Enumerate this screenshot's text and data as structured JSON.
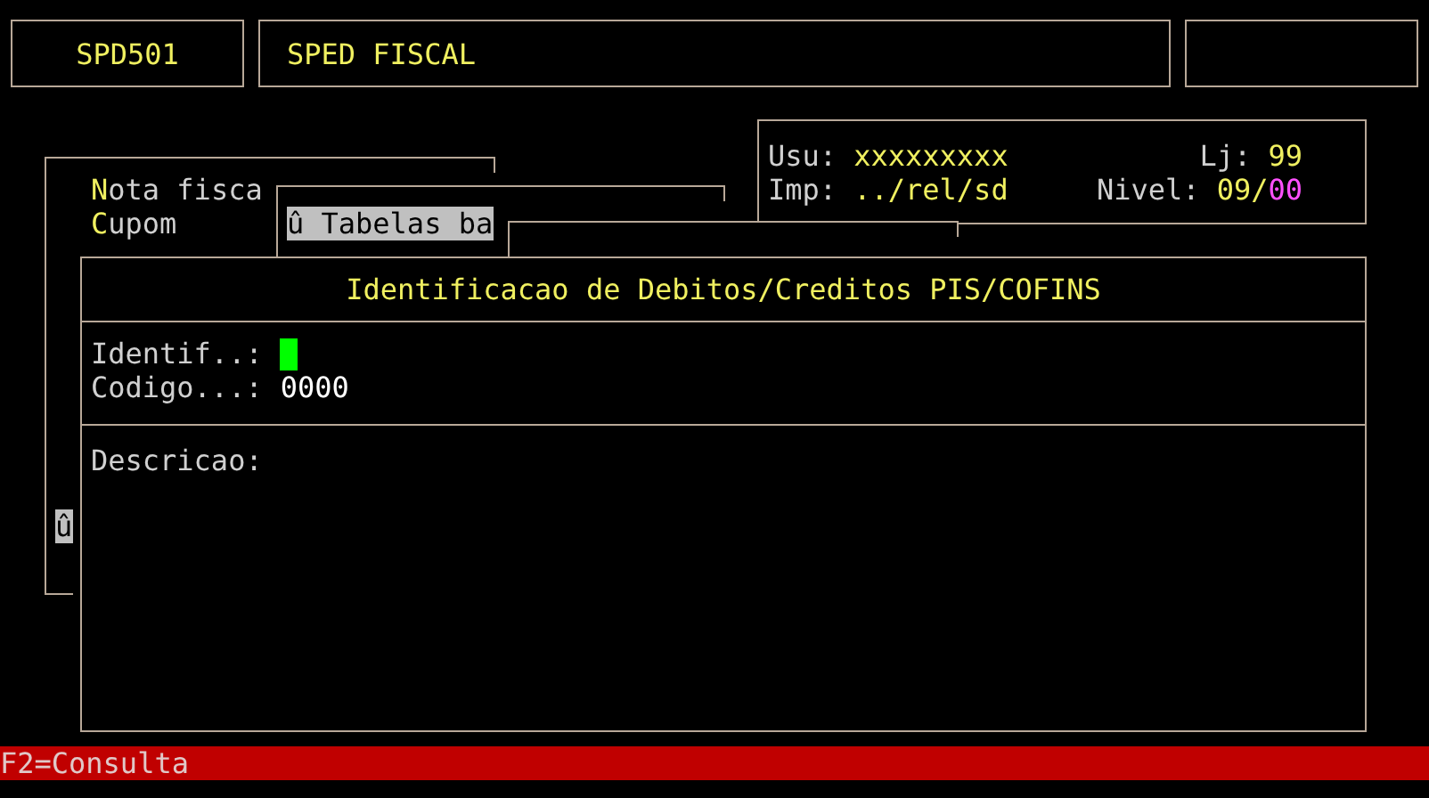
{
  "header": {
    "program_code": "SPD501",
    "program_title": "SPED FISCAL"
  },
  "session": {
    "user_label": "Usu:",
    "user": "xxxxxxxxx",
    "store_label": "Lj:",
    "store": "99",
    "printer_label": "Imp:",
    "printer": "../rel/sd",
    "level_label": "Nivel:",
    "level_main": "09/",
    "level_sub": "00"
  },
  "menus": [
    {
      "items": [
        {
          "label": "Nota fisca",
          "selected": false
        },
        {
          "label": "Cupom",
          "selected": false
        }
      ],
      "scroll_marker": "û"
    },
    {
      "items": [
        {
          "label": "û Tabelas ba",
          "selected": true
        }
      ]
    }
  ],
  "dialog": {
    "title": "Identificacao de Debitos/Creditos PIS/COFINS",
    "fields": [
      {
        "label": "Identif..:",
        "kind": "cursor"
      },
      {
        "label": "Codigo...:",
        "value": "0000",
        "kind": "text"
      }
    ],
    "description_label": "Descricao:"
  },
  "status_bar": "F2=Consulta"
}
